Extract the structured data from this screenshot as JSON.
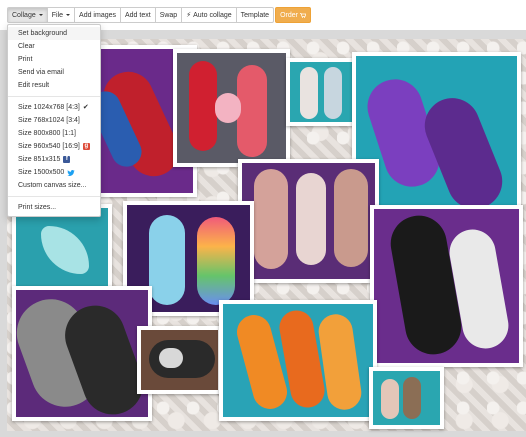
{
  "toolbar": {
    "collage": "Collage",
    "file": "File",
    "add_images": "Add images",
    "add_text": "Add text",
    "swap": "Swap",
    "auto_collage": "Auto collage",
    "template": "Template",
    "order": "Order"
  },
  "menu": {
    "set_background": "Set background",
    "clear": "Clear",
    "print": "Print",
    "send_via_email": "Send via email",
    "edit_result": "Edit result",
    "size_1024": "Size 1024x768 [4:3]",
    "size_768": "Size 768x1024 [3:4]",
    "size_800": "Size 800x800 [1:1]",
    "size_960": "Size 960x540 [16:9]",
    "size_851": "Size 851x315",
    "size_1500": "Size 1500x500",
    "custom": "Custom canvas size...",
    "print_sizes": "Print sizes..."
  },
  "icons": {
    "selected_size": "check-icon",
    "facebook": "facebook-icon",
    "google_plus": "google-plus-icon",
    "twitter": "twitter-icon"
  },
  "colors": {
    "order_button": "#f0ad4e",
    "facebook": "#3b5998",
    "google_plus": "#dd4b39",
    "twitter": "#1da1f2",
    "canvas_bg": "#d9d9d9"
  },
  "canvas": {
    "photos": [
      {
        "name": "photo-spiderman-pads"
      },
      {
        "name": "photo-red-pads-box"
      },
      {
        "name": "photo-small-pads"
      },
      {
        "name": "photo-purple-pads"
      },
      {
        "name": "photo-floral-pads"
      },
      {
        "name": "photo-teal-lotus"
      },
      {
        "name": "photo-rainbow-pads"
      },
      {
        "name": "photo-starwars-pads"
      },
      {
        "name": "photo-grey-bat-pads"
      },
      {
        "name": "photo-black-white-pad"
      },
      {
        "name": "photo-orange-floral-pads"
      },
      {
        "name": "photo-small-bottom-pads"
      }
    ]
  }
}
